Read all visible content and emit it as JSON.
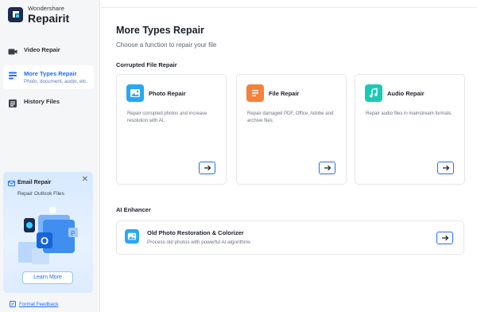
{
  "brand": {
    "top": "Wondershare",
    "name": "Repairit"
  },
  "sidebar": {
    "items": [
      {
        "label": "Video Repair",
        "sub": "",
        "icon": "video-camera-icon"
      },
      {
        "label": "More Types Repair",
        "sub": "Photo, document, audio, etc.",
        "icon": "more-types-icon"
      },
      {
        "label": "History Files",
        "sub": "",
        "icon": "history-icon"
      }
    ],
    "promo": {
      "title": "Email Repair",
      "subtitle": "Repair Outlook Files",
      "button": "Learn More"
    },
    "feedback": "Format Feedback"
  },
  "main": {
    "title": "More Types Repair",
    "subtitle": "Choose a function to repair your file",
    "section_corrupted": "Corrupted File Repair",
    "cards": [
      {
        "title": "Photo Repair",
        "desc": "Repair corrupted photos and increase resolution with AI.",
        "icon": "photo-icon",
        "color": "#2aa6f5"
      },
      {
        "title": "File Repair",
        "desc": "Repair damaged PDF, Office, Adobe and archive files.",
        "icon": "document-icon",
        "color": "#f5813a"
      },
      {
        "title": "Audio Repair",
        "desc": "Repair audio files in mainstream formats.",
        "icon": "music-note-icon",
        "color": "#1cc9b5"
      }
    ],
    "section_ai": "AI Enhancer",
    "ai_card": {
      "title": "Old Photo Restoration & Colorizer",
      "desc": "Process old photos with powerful AI algorithms",
      "icon": "photo-icon",
      "color": "#2aa6f5"
    }
  },
  "colors": {
    "accent": "#1f6dff",
    "sidebar_bg": "#f5f6f8"
  }
}
